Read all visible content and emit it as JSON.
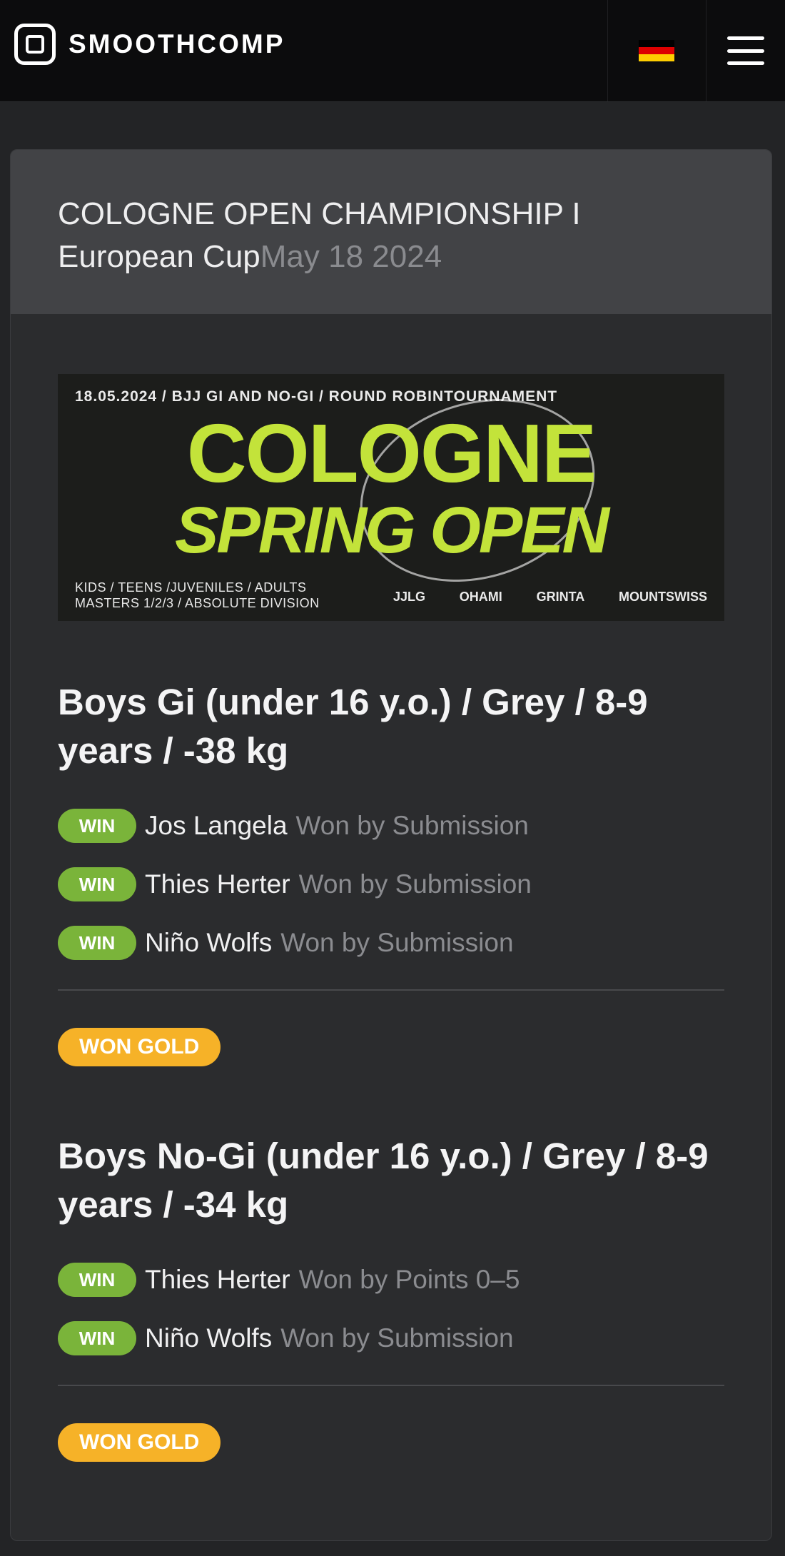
{
  "header": {
    "brand": "SMOOTHCOMP",
    "language_flag_icon": "germany-flag-icon",
    "menu_icon": "hamburger-menu-icon",
    "flag_colors": [
      "#000000",
      "#dd0000",
      "#ffce00"
    ]
  },
  "event": {
    "title": "COLOGNE OPEN CHAMPIONSHIP I European Cup",
    "date": "May 18 2024"
  },
  "banner": {
    "top_line": "18.05.2024 / BJJ GI AND NO-GI / ROUND ROBINTOURNAMENT",
    "headline1": "COLOGNE",
    "headline2": "SPRING OPEN",
    "bottom_line1": "KIDS / TEENS /JUVENILES / ADULTS",
    "bottom_line2": "MASTERS 1/2/3 / ABSOLUTE DIVISION",
    "sponsors": [
      "JJLG",
      "OHAMI",
      "GRINTA",
      "MOUNTSWISS"
    ]
  },
  "divisions": [
    {
      "title": "Boys Gi (under 16 y.o.) / Grey / 8-9 years / -38 kg",
      "matches": [
        {
          "result": "WIN",
          "opponent": "Jos Langela",
          "method": "Won by Submission"
        },
        {
          "result": "WIN",
          "opponent": "Thies Herter",
          "method": "Won by Submission"
        },
        {
          "result": "WIN",
          "opponent": "Niño Wolfs",
          "method": "Won by Submission"
        }
      ],
      "placement": "WON GOLD"
    },
    {
      "title": "Boys No-Gi (under 16 y.o.) / Grey / 8-9 years / -34 kg",
      "matches": [
        {
          "result": "WIN",
          "opponent": "Thies Herter",
          "method": "Won by Points 0–5"
        },
        {
          "result": "WIN",
          "opponent": "Niño Wolfs",
          "method": "Won by Submission"
        }
      ],
      "placement": "WON GOLD"
    }
  ],
  "colors": {
    "win_badge": "#7ab43a",
    "gold_badge": "#f6b228",
    "banner_accent": "#c3e33a"
  }
}
